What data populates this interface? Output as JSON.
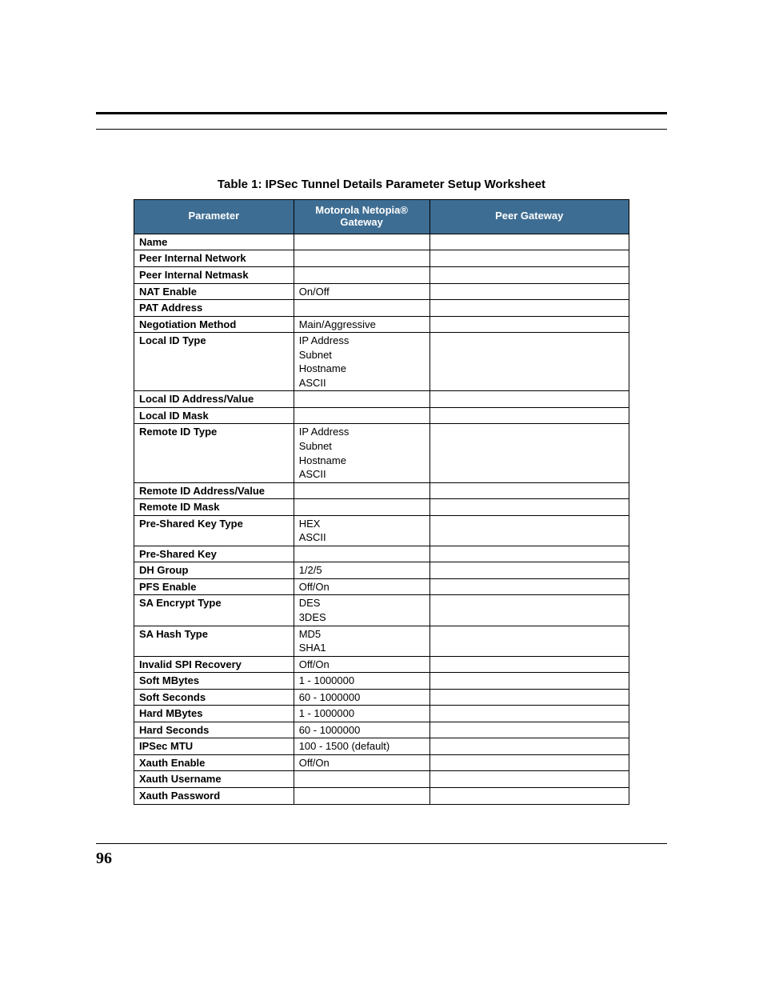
{
  "caption": "Table 1: IPSec Tunnel Details Parameter Setup Worksheet",
  "headers": {
    "c1": "Parameter",
    "c2": "Motorola Netopia®\nGateway",
    "c3": "Peer Gateway"
  },
  "chart_data": {
    "type": "table",
    "title": "IPSec Tunnel Details Parameter Setup Worksheet",
    "columns": [
      "Parameter",
      "Motorola Netopia® Gateway",
      "Peer Gateway"
    ],
    "rows": [
      {
        "param": "Name",
        "gw": "",
        "peer": ""
      },
      {
        "param": "Peer Internal Network",
        "gw": "",
        "peer": ""
      },
      {
        "param": "Peer Internal Netmask",
        "gw": "",
        "peer": ""
      },
      {
        "param": "NAT Enable",
        "gw": "On/Off",
        "peer": ""
      },
      {
        "param": "PAT Address",
        "gw": "",
        "peer": ""
      },
      {
        "param": "Negotiation Method",
        "gw": "Main/Aggressive",
        "peer": ""
      },
      {
        "param": "Local ID Type",
        "gw": "IP Address\nSubnet\nHostname\nASCII",
        "peer": ""
      },
      {
        "param": "Local ID Address/Value",
        "gw": "",
        "peer": ""
      },
      {
        "param": "Local ID Mask",
        "gw": "",
        "peer": ""
      },
      {
        "param": "Remote ID Type",
        "gw": "IP Address\nSubnet\nHostname\nASCII",
        "peer": ""
      },
      {
        "param": "Remote ID Address/Value",
        "gw": "",
        "peer": ""
      },
      {
        "param": "Remote ID Mask",
        "gw": "",
        "peer": ""
      },
      {
        "param": "Pre-Shared Key Type",
        "gw": "HEX\nASCII",
        "peer": ""
      },
      {
        "param": "Pre-Shared Key",
        "gw": "",
        "peer": ""
      },
      {
        "param": "DH Group",
        "gw": "1/2/5",
        "peer": ""
      },
      {
        "param": "PFS Enable",
        "gw": "Off/On",
        "peer": ""
      },
      {
        "param": "SA Encrypt Type",
        "gw": "DES\n3DES",
        "peer": ""
      },
      {
        "param": "SA Hash Type",
        "gw": "MD5\nSHA1",
        "peer": ""
      },
      {
        "param": "Invalid SPI Recovery",
        "gw": "Off/On",
        "peer": ""
      },
      {
        "param": "Soft MBytes",
        "gw": "1 - 1000000",
        "peer": ""
      },
      {
        "param": "Soft Seconds",
        "gw": "60 - 1000000",
        "peer": ""
      },
      {
        "param": "Hard MBytes",
        "gw": "1 - 1000000",
        "peer": ""
      },
      {
        "param": "Hard Seconds",
        "gw": "60 - 1000000",
        "peer": ""
      },
      {
        "param": "IPSec MTU",
        "gw": "100 - 1500 (default)",
        "peer": ""
      },
      {
        "param": "Xauth Enable",
        "gw": "Off/On",
        "peer": ""
      },
      {
        "param": "Xauth Username",
        "gw": "",
        "peer": ""
      },
      {
        "param": "Xauth Password",
        "gw": "",
        "peer": ""
      }
    ]
  },
  "page_number": "96"
}
